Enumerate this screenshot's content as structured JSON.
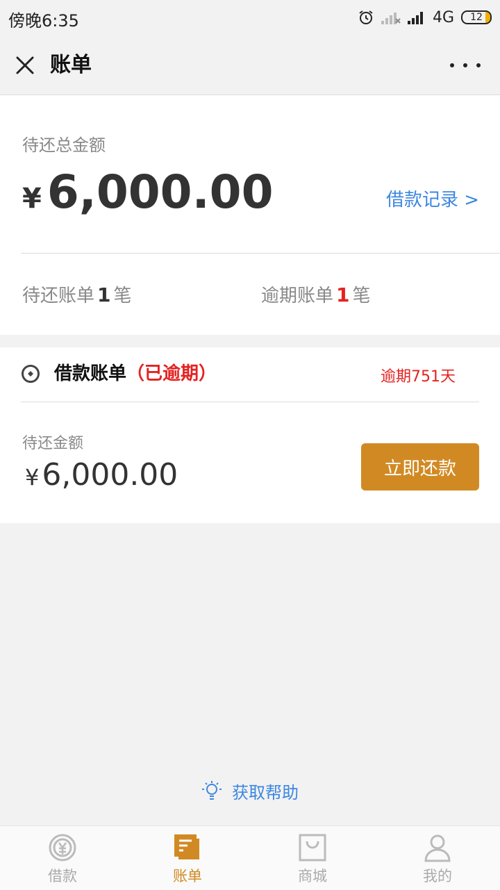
{
  "status_bar": {
    "time": "傍晚6:35",
    "network": "4G",
    "battery": "12",
    "icons": [
      "alarm-icon",
      "signal-x-icon",
      "signal-icon"
    ]
  },
  "nav": {
    "title": "账单",
    "close_icon": "close-icon",
    "more_icon": "more-icon"
  },
  "summary": {
    "total_label": "待还总金额",
    "currency": "¥",
    "total_amount": "6,000.00",
    "loan_record_link": "借款记录 >",
    "pending_bills_prefix": "待还账单",
    "pending_bills_count": "1",
    "pending_bills_suffix": "笔",
    "overdue_bills_prefix": "逾期账单",
    "overdue_bills_count": "1",
    "overdue_bills_suffix": "笔"
  },
  "bill": {
    "title": "借款账单",
    "status": "（已逾期）",
    "overdue_days": "逾期751天",
    "pending_label": "待还金额",
    "currency": "¥",
    "amount": "6,000.00",
    "repay_button": "立即还款"
  },
  "help": {
    "text": "获取帮助",
    "icon": "lightbulb-icon"
  },
  "tab_bar": {
    "tabs": [
      {
        "label": "借款",
        "icon": "yen-coin-icon"
      },
      {
        "label": "账单",
        "icon": "bill-icon"
      },
      {
        "label": "商城",
        "icon": "shopping-bag-icon"
      },
      {
        "label": "我的",
        "icon": "person-icon"
      }
    ],
    "active_index": 1
  },
  "colors": {
    "accent": "#d18a23",
    "link": "#3d86e0",
    "danger": "#e42222",
    "inactive": "#aaaaaa"
  }
}
